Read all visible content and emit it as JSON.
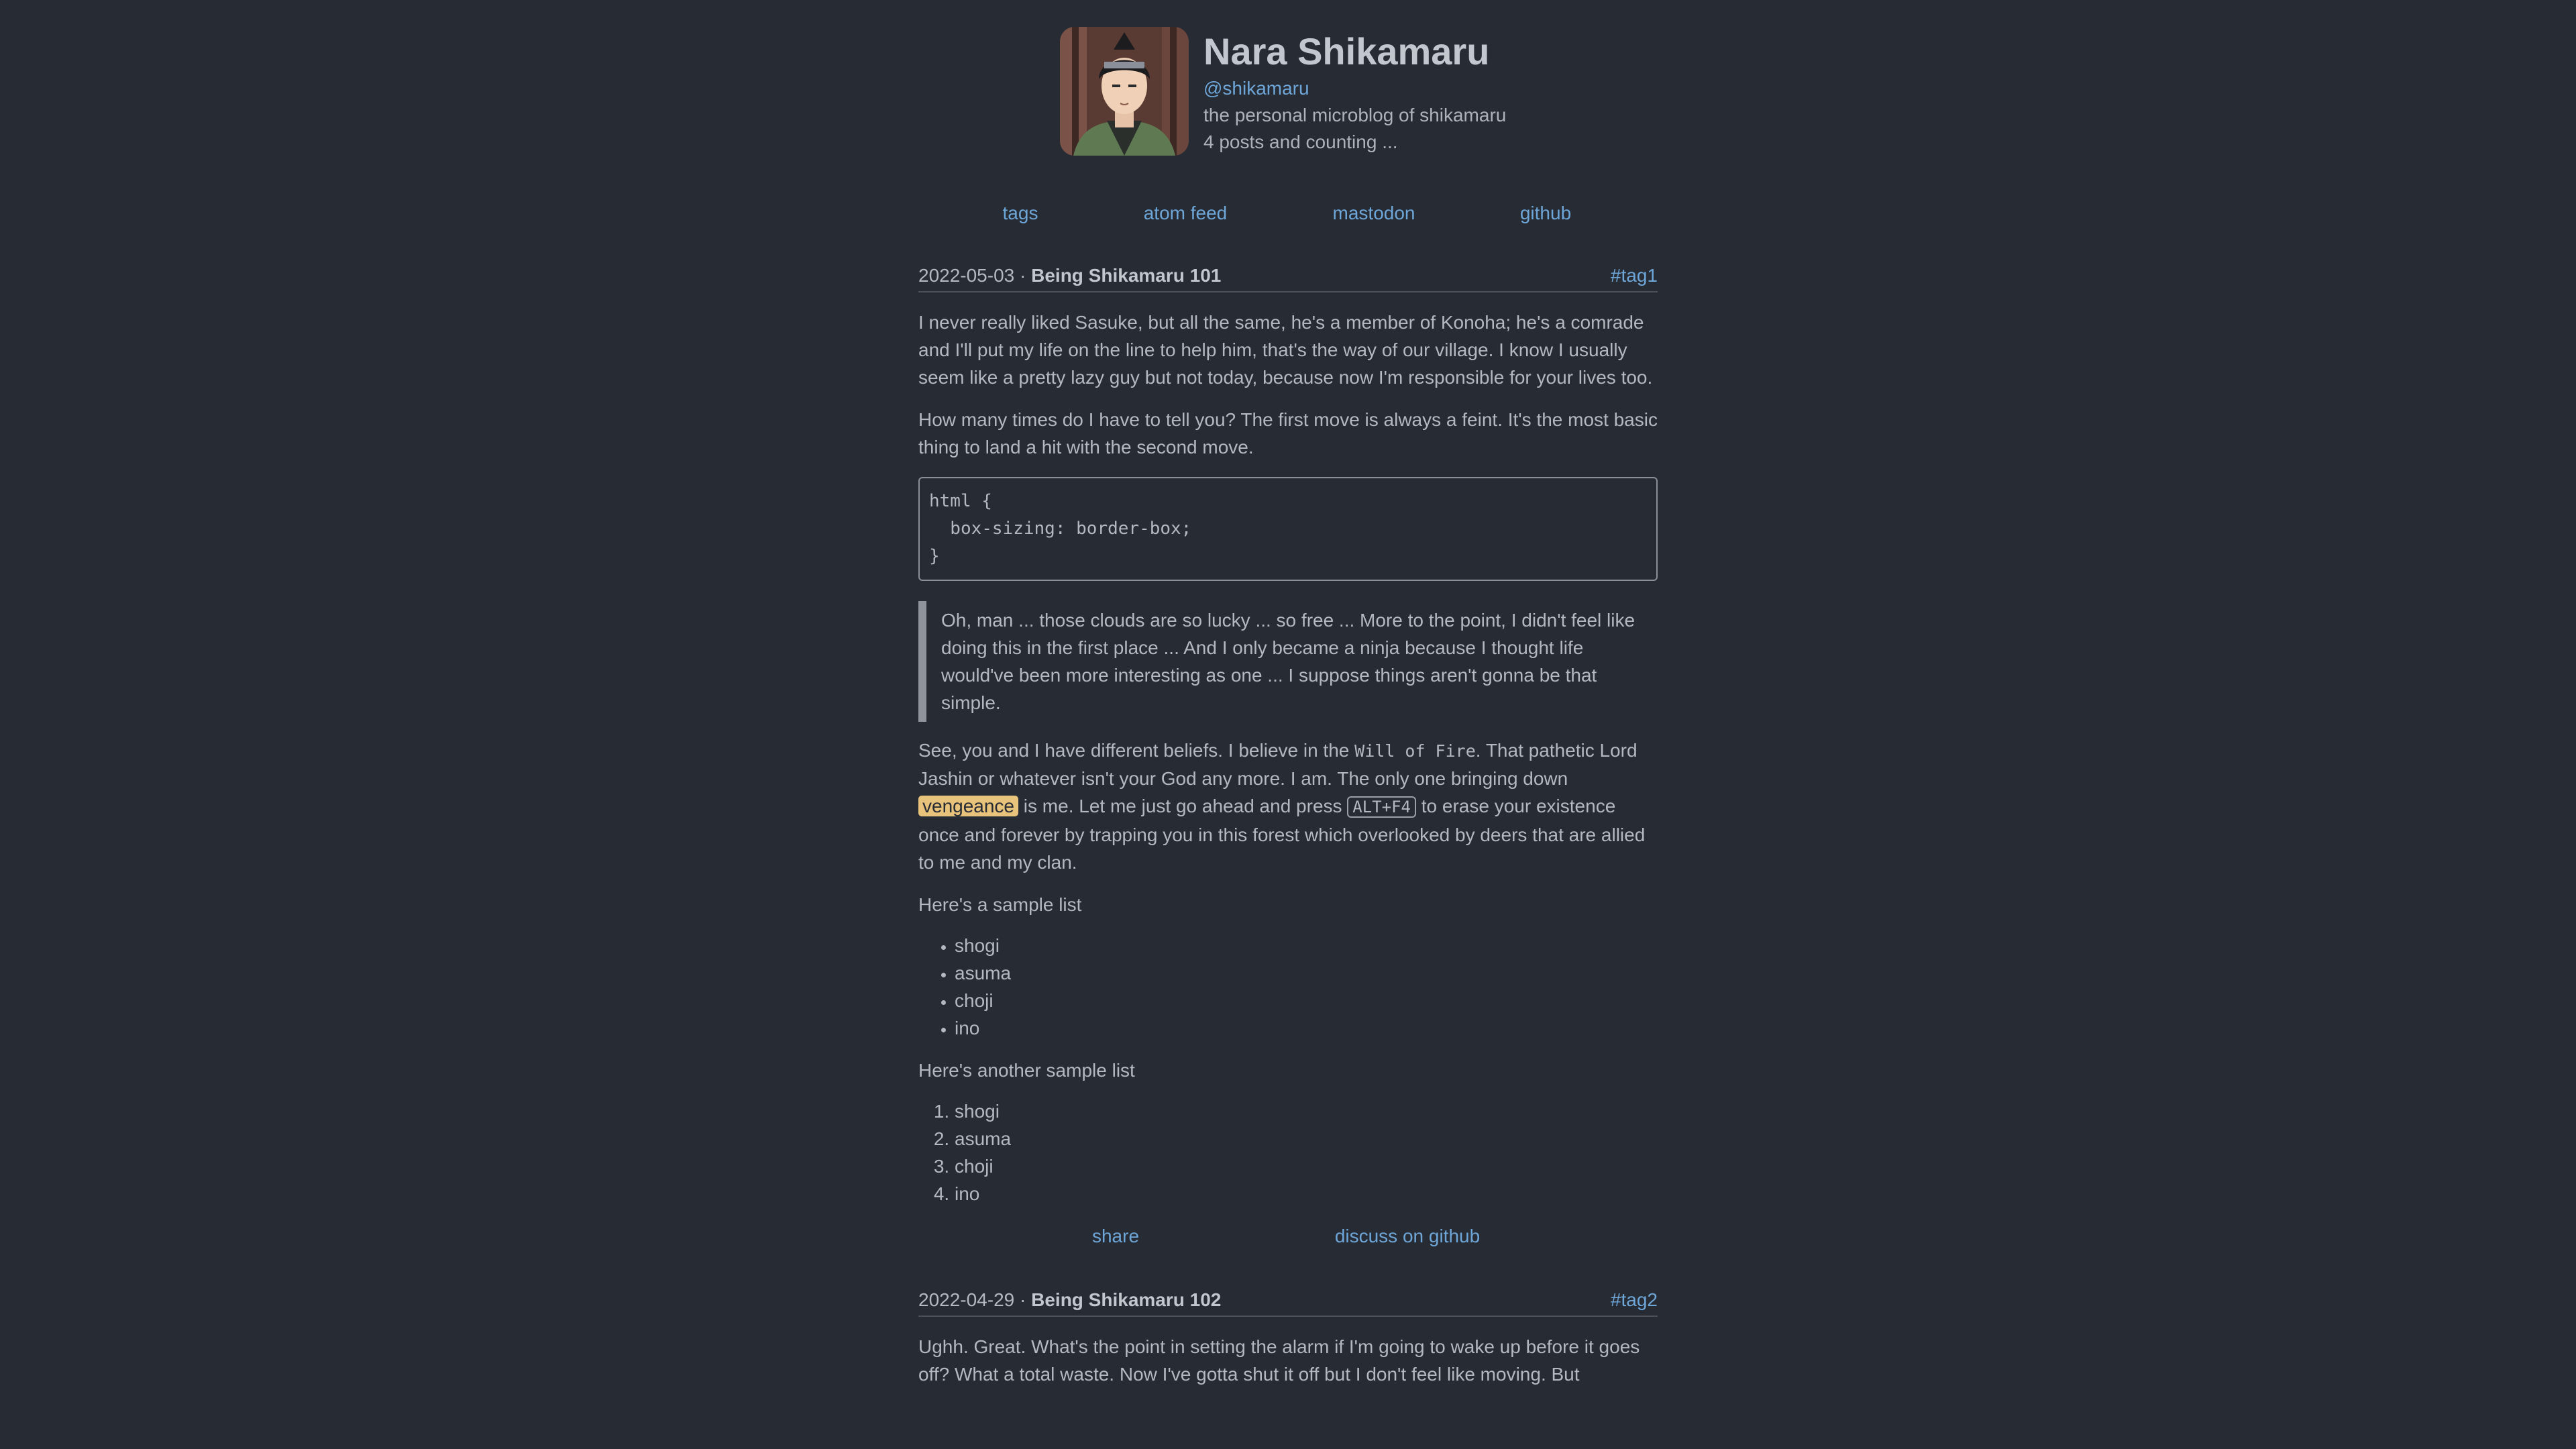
{
  "profile": {
    "name": "Nara Shikamaru",
    "handle": "@shikamaru",
    "tagline": "the personal microblog of shikamaru",
    "post_count": "4 posts and counting ..."
  },
  "nav": [
    {
      "label": "tags"
    },
    {
      "label": "atom feed"
    },
    {
      "label": "mastodon"
    },
    {
      "label": "github"
    }
  ],
  "posts": [
    {
      "date": "2022-05-03",
      "separator": "·",
      "title": "Being Shikamaru 101",
      "tag": "#tag1",
      "para1": "I never really liked Sasuke, but all the same, he's a member of Konoha; he's a comrade and I'll put my life on the line to help him, that's the way of our village. I know I usually seem like a pretty lazy guy but not today, because now I'm responsible for your lives too.",
      "para2": "How many times do I have to tell you? The first move is always a feint. It's the most basic thing to land a hit with the second move.",
      "code": "html {\n  box-sizing: border-box;\n}",
      "quote": "Oh, man ... those clouds are so lucky ... so free ... More to the point, I didn't feel like doing this in the first place ... And I only became a ninja because I thought life would've been more interesting as one ... I suppose things aren't gonna be that simple.",
      "para3_a": "See, you and I have different beliefs. I believe in the ",
      "para3_code": "Will of Fire",
      "para3_b": ". That pathetic Lord Jashin or whatever isn't your God any more. I am. The only one bringing down ",
      "para3_mark": "vengeance",
      "para3_c": " is me. Let me just go ahead and press ",
      "para3_kbd": "ALT+F4",
      "para3_d": " to erase your existence once and forever by trapping you in this forest which overlooked by deers that are allied to me and my clan.",
      "list1_intro": "Here's a sample list",
      "list1": [
        "shogi",
        "asuma",
        "choji",
        "ino"
      ],
      "list2_intro": "Here's another sample list",
      "list2": [
        "shogi",
        "asuma",
        "choji",
        "ino"
      ],
      "share_label": "share",
      "discuss_label": "discuss on github"
    },
    {
      "date": "2022-04-29",
      "separator": "·",
      "title": "Being Shikamaru 102",
      "tag": "#tag2",
      "para1": "Ughh. Great. What's the point in setting the alarm if I'm going to wake up before it goes off? What a total waste. Now I've gotta shut it off but I don't feel like moving. But"
    }
  ]
}
